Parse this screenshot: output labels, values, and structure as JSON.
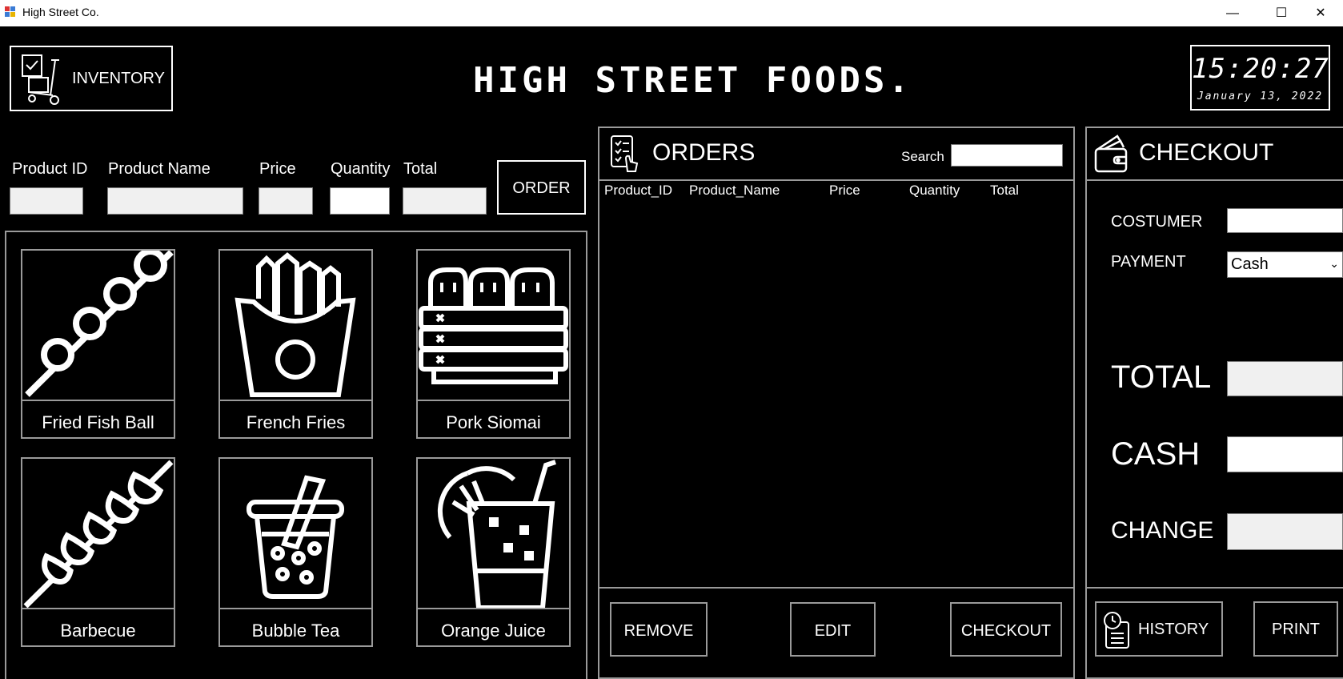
{
  "window": {
    "title": "High Street Co.",
    "minimize": "—",
    "maximize": "☐",
    "close": "✕"
  },
  "header": {
    "inventory_label": "INVENTORY",
    "brand": "HIGH STREET FOODS.",
    "clock_time": "15:20:27",
    "clock_date": "January 13, 2022"
  },
  "order_form": {
    "labels": {
      "product_id": "Product ID",
      "product_name": "Product Name",
      "price": "Price",
      "quantity": "Quantity",
      "total": "Total"
    },
    "values": {
      "product_id": "",
      "product_name": "",
      "price": "",
      "quantity": "",
      "total": ""
    },
    "order_button": "ORDER"
  },
  "products": [
    {
      "name": "Fried Fish Ball",
      "icon": "fish-ball-skewer-icon"
    },
    {
      "name": "French Fries",
      "icon": "french-fries-icon"
    },
    {
      "name": "Pork Siomai",
      "icon": "siomai-icon"
    },
    {
      "name": "Barbecue",
      "icon": "barbecue-skewer-icon"
    },
    {
      "name": "Bubble Tea",
      "icon": "bubble-tea-icon"
    },
    {
      "name": "Orange Juice",
      "icon": "orange-juice-icon"
    }
  ],
  "orders": {
    "title": "ORDERS",
    "search_label": "Search",
    "search_value": "",
    "columns": [
      "Product_ID",
      "Product_Name",
      "Price",
      "Quantity",
      "Total"
    ],
    "rows": [],
    "buttons": {
      "remove": "REMOVE",
      "edit": "EDIT",
      "checkout": "CHECKOUT"
    }
  },
  "checkout": {
    "title": "CHECKOUT",
    "customer_label": "COSTUMER",
    "customer_value": "",
    "payment_label": "PAYMENT",
    "payment_value": "Cash",
    "total_label": "TOTAL",
    "total_value": "",
    "cash_label": "CASH",
    "cash_value": "",
    "change_label": "CHANGE",
    "change_value": "",
    "history_label": "HISTORY",
    "print_label": "PRINT"
  },
  "colors": {
    "background": "#000000",
    "foreground": "#ffffff",
    "panel_border": "#9a9a9a",
    "field_bg": "#f0f0f0"
  }
}
